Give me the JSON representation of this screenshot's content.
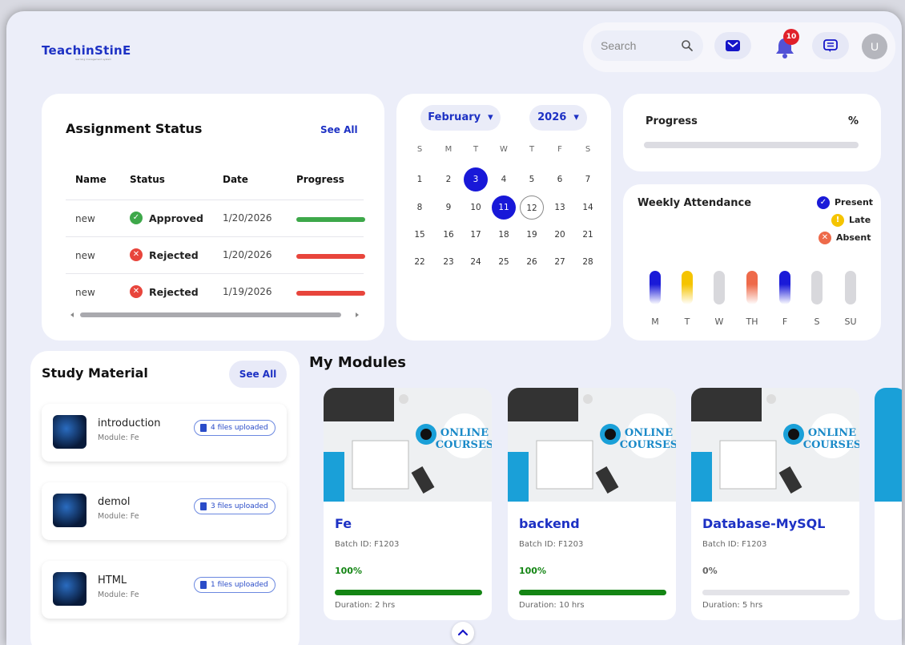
{
  "brand": {
    "logo_text": "TeachinStinE",
    "tagline": "learning management system"
  },
  "topbar": {
    "search_placeholder": "Search",
    "notification_count": "10",
    "avatar_initial": "U"
  },
  "assignment_status": {
    "title": "Assignment Status",
    "see_all": "See All",
    "columns": [
      "Name",
      "Status",
      "Date",
      "Progress"
    ],
    "rows": [
      {
        "name": "new",
        "status": "Approved",
        "date": "1/20/2026",
        "status_color": "#3ea84a"
      },
      {
        "name": "new",
        "status": "Rejected",
        "date": "1/20/2026",
        "status_color": "#e8453c"
      },
      {
        "name": "new",
        "status": "Rejected",
        "date": "1/19/2026",
        "status_color": "#e8453c"
      }
    ]
  },
  "calendar": {
    "month": "February",
    "year": "2026",
    "weekdays": [
      "S",
      "M",
      "T",
      "W",
      "T",
      "F",
      "S"
    ],
    "days": [
      "1",
      "2",
      "3",
      "4",
      "5",
      "6",
      "7",
      "8",
      "9",
      "10",
      "11",
      "12",
      "13",
      "14",
      "15",
      "16",
      "17",
      "18",
      "19",
      "20",
      "21",
      "22",
      "23",
      "24",
      "25",
      "26",
      "27",
      "28"
    ],
    "highlighted_days": [
      "3",
      "11"
    ],
    "today": "12"
  },
  "progress": {
    "title": "Progress",
    "unit": "%",
    "value": 0
  },
  "weekly_attendance": {
    "title": "Weekly Attendance",
    "legend": [
      "Present",
      "Late",
      "Absent"
    ],
    "days": [
      "M",
      "T",
      "W",
      "TH",
      "F",
      "S",
      "SU"
    ],
    "status": [
      "present",
      "late",
      "none",
      "absent",
      "present",
      "none",
      "none"
    ],
    "colors": {
      "present": "#1a1ad8",
      "late": "#f5c400",
      "absent": "#ee6a4a",
      "none": "#d8d8dc"
    }
  },
  "study_material": {
    "title": "Study Material",
    "see_all": "See All",
    "items": [
      {
        "name": "introduction",
        "module": "Module: Fe",
        "files": "4 files uploaded"
      },
      {
        "name": "demol",
        "module": "Module: Fe",
        "files": "3 files uploaded"
      },
      {
        "name": "HTML",
        "module": "Module: Fe",
        "files": "1 files uploaded"
      }
    ]
  },
  "modules": {
    "title": "My Modules",
    "image_text": [
      "ONLINE",
      "COURSES"
    ],
    "items": [
      {
        "name": "Fe",
        "batch": "Batch ID: F1203",
        "progress": "100%",
        "progress_value": 100,
        "duration": "Duration: 2 hrs"
      },
      {
        "name": "backend",
        "batch": "Batch ID: F1203",
        "progress": "100%",
        "progress_value": 100,
        "duration": "Duration: 10 hrs"
      },
      {
        "name": "Database-MySQL",
        "batch": "Batch ID: F1203",
        "progress": "0%",
        "progress_value": 0,
        "duration": "Duration: 5 hrs"
      }
    ]
  }
}
